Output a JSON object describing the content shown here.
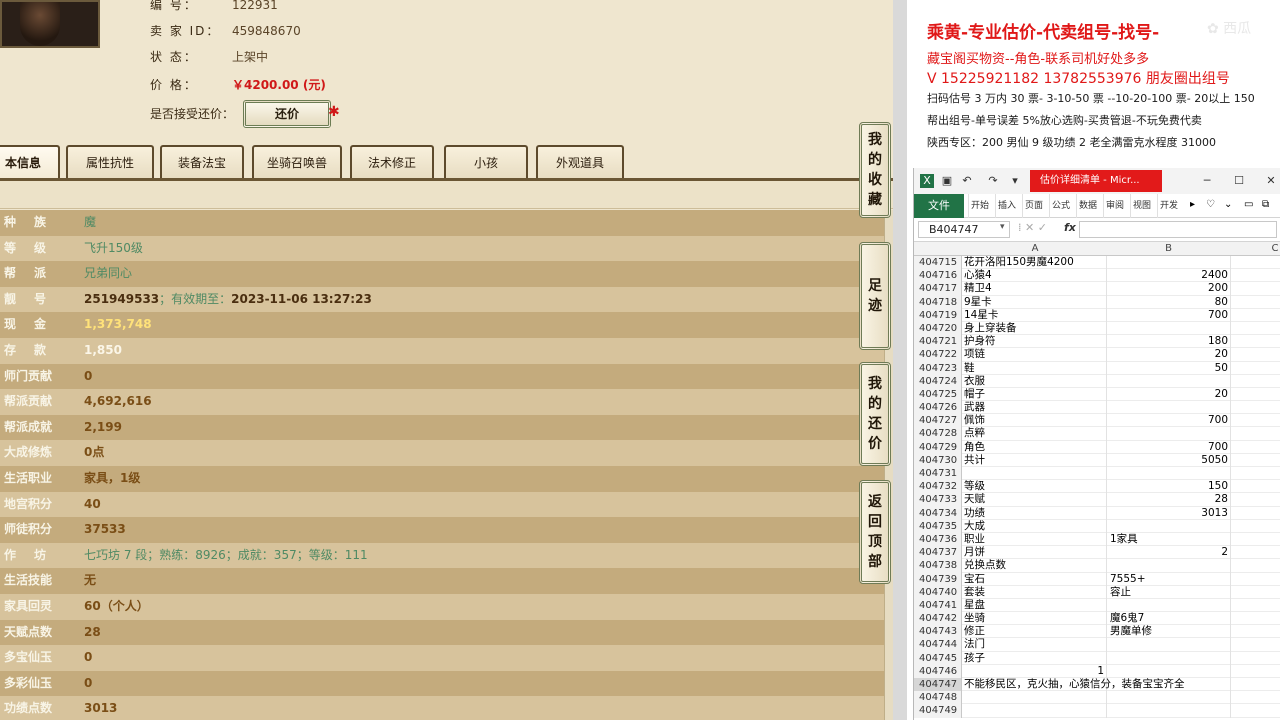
{
  "game": {
    "info": [
      {
        "label": "编      号：",
        "value": "122931",
        "style": "val"
      },
      {
        "label": "卖  家  ID：",
        "value": "459848670",
        "style": "val"
      },
      {
        "label": "状      态：",
        "value": "上架中",
        "style": "val"
      },
      {
        "label": "价      格：",
        "value": "￥4200.00 (元)",
        "style": "price"
      }
    ],
    "accept_counter_label": "是否接受还价：",
    "counter_button": "还价",
    "counter_mark": "✱",
    "tabs": [
      "本信息",
      "属性抗性",
      "装备法宝",
      "坐骑召唤兽",
      "法术修正",
      "小孩",
      "外观道具"
    ],
    "rows": [
      {
        "k": "种族",
        "spread": true,
        "v": "魔",
        "cls": "green"
      },
      {
        "k": "等级",
        "spread": true,
        "v": "飞升150级",
        "cls": "green"
      },
      {
        "k": "帮派",
        "spread": true,
        "v": "兄弟同心",
        "cls": "green"
      },
      {
        "k": "靓号",
        "spread": true,
        "v": "251949533",
        "v2": "；有效期至：",
        "v3": "2023-11-06 13:27:23",
        "cls": "dark"
      },
      {
        "k": "现金",
        "spread": true,
        "v": "1,373,748",
        "cls": "gold"
      },
      {
        "k": "存款",
        "spread": true,
        "v": "1,850",
        "cls": ""
      },
      {
        "k": "师门贡献",
        "spread": false,
        "v": "0",
        "cls": "brown"
      },
      {
        "k": "帮派贡献",
        "spread": false,
        "v": "4,692,616",
        "cls": "brown"
      },
      {
        "k": "帮派成就",
        "spread": false,
        "v": "2,199",
        "cls": "brown"
      },
      {
        "k": "大成修炼",
        "spread": false,
        "v": "0点",
        "cls": "brown"
      },
      {
        "k": "生活职业",
        "spread": false,
        "v": "家具，1级",
        "cls": "brown"
      },
      {
        "k": "地宫积分",
        "spread": false,
        "v": "40",
        "cls": "brown"
      },
      {
        "k": "师徒积分",
        "spread": false,
        "v": "37533",
        "cls": "brown"
      },
      {
        "k": "作坊",
        "spread": true,
        "v": "七巧坊 7 段；熟练：8926；成就：357；等级：111",
        "cls": "workshop"
      },
      {
        "k": "生活技能",
        "spread": false,
        "v": "无",
        "cls": "brown"
      },
      {
        "k": "家具回灵",
        "spread": false,
        "v": "60（个人）",
        "cls": "brown"
      },
      {
        "k": "天赋点数",
        "spread": false,
        "v": "28",
        "cls": "brown"
      },
      {
        "k": "多宝仙玉",
        "spread": false,
        "v": "0",
        "cls": "brown"
      },
      {
        "k": "多彩仙玉",
        "spread": false,
        "v": "0",
        "cls": "brown"
      },
      {
        "k": "功绩点数",
        "spread": false,
        "v": "3013",
        "cls": "brown"
      }
    ],
    "side_buttons": [
      {
        "chars": [
          "我",
          "的",
          "收",
          "藏"
        ],
        "name": "my-favorites-button"
      },
      {
        "chars": [
          "足",
          "迹"
        ],
        "name": "footprint-button"
      },
      {
        "chars": [
          "我",
          "的",
          "还",
          "价"
        ],
        "name": "my-counteroffers-button"
      },
      {
        "chars": [
          "返",
          "回",
          "顶",
          "部"
        ],
        "name": "back-to-top-button"
      }
    ]
  },
  "doc": {
    "line1": "乘黄-专业估价-代卖组号-找号-",
    "line2": "藏宝阁买物资--角色-联系司机好处多多",
    "line3": "V 15225921182   13782553976 朋友圈出组号",
    "line4": "扫码估号 3 万内 30 票- 3-10-50 票  --10-20-100 票- 20以上 150",
    "line5": "帮出组号-单号误差 5%放心选购-买贵管退-不玩免费代卖",
    "line6": "陕西专区：200 男仙 9 级功绩 2 老全满雷克水程度 31000",
    "watermark": "✿ 西瓜"
  },
  "excel": {
    "window_title": "估价详细清单 - Micr...",
    "file_tab": "文件",
    "ribbon_tabs": [
      "开始",
      "插入",
      "页面",
      "公式",
      "数据",
      "审阅",
      "视图",
      "开发"
    ],
    "name_box": "B404747",
    "fx": "fx",
    "columns": [
      "A",
      "B",
      "C"
    ],
    "rows": [
      {
        "n": "404715",
        "a": "花开洛阳150男魔4200",
        "b": ""
      },
      {
        "n": "404716",
        "a": "心猿4",
        "b": "2400",
        "num": true
      },
      {
        "n": "404717",
        "a": "精卫4",
        "b": "200",
        "num": true
      },
      {
        "n": "404718",
        "a": "9星卡",
        "b": "80",
        "num": true
      },
      {
        "n": "404719",
        "a": "14星卡",
        "b": "700",
        "num": true
      },
      {
        "n": "404720",
        "a": "身上穿装备",
        "b": ""
      },
      {
        "n": "404721",
        "a": "护身符",
        "b": "180",
        "num": true
      },
      {
        "n": "404722",
        "a": "项链",
        "b": "20",
        "num": true
      },
      {
        "n": "404723",
        "a": "鞋",
        "b": "50",
        "num": true
      },
      {
        "n": "404724",
        "a": "衣服",
        "b": ""
      },
      {
        "n": "404725",
        "a": "帽子",
        "b": "20",
        "num": true
      },
      {
        "n": "404726",
        "a": "武器",
        "b": ""
      },
      {
        "n": "404727",
        "a": "佩饰",
        "b": "700",
        "num": true
      },
      {
        "n": "404728",
        "a": "点粹",
        "b": ""
      },
      {
        "n": "404729",
        "a": "角色",
        "b": "700",
        "num": true
      },
      {
        "n": "404730",
        "a": "共计",
        "b": "5050",
        "num": true
      },
      {
        "n": "404731",
        "a": "",
        "b": ""
      },
      {
        "n": "404732",
        "a": "等级",
        "b": "150",
        "num": true
      },
      {
        "n": "404733",
        "a": "天赋",
        "b": "28",
        "num": true
      },
      {
        "n": "404734",
        "a": "功绩",
        "b": "3013",
        "num": true
      },
      {
        "n": "404735",
        "a": "大成",
        "b": ""
      },
      {
        "n": "404736",
        "a": "职业",
        "b": "1家具"
      },
      {
        "n": "404737",
        "a": "月饼",
        "b": "2",
        "num": true
      },
      {
        "n": "404738",
        "a": "兑换点数",
        "b": ""
      },
      {
        "n": "404739",
        "a": "宝石",
        "b": "7555+"
      },
      {
        "n": "404740",
        "a": "套装",
        "b": "容止"
      },
      {
        "n": "404741",
        "a": "星盘",
        "b": ""
      },
      {
        "n": "404742",
        "a": "坐骑",
        "b": "魔6鬼7"
      },
      {
        "n": "404743",
        "a": "修正",
        "b": "男魔单修"
      },
      {
        "n": "404744",
        "a": "法门",
        "b": ""
      },
      {
        "n": "404745",
        "a": "孩子",
        "b": ""
      },
      {
        "n": "404746",
        "a": "",
        "a_right": "1",
        "b": ""
      },
      {
        "n": "404747",
        "a": "不能移民区，克火抽，心猿信分，装备宝宝齐全",
        "b": "",
        "sel": true
      },
      {
        "n": "404748",
        "a": "",
        "b": ""
      },
      {
        "n": "404749",
        "a": "",
        "b": ""
      }
    ]
  }
}
